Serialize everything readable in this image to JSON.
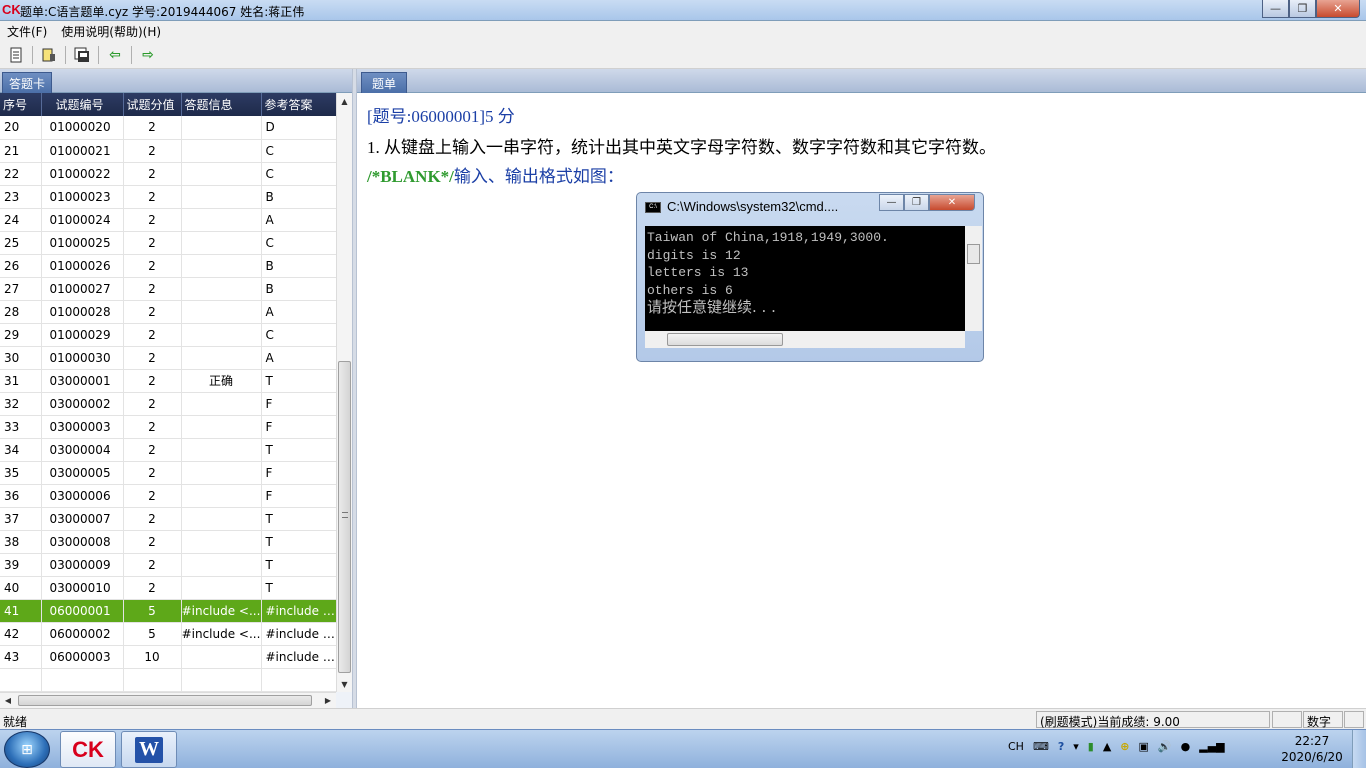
{
  "window": {
    "logo": "CK",
    "title": "题单:C语言题单.cyz  学号:2019444067 姓名:蒋正伟",
    "controls": {
      "min": "—",
      "max": "❐",
      "close": "✕"
    }
  },
  "menu": [
    "文件(F)",
    "使用说明(帮助)(H)"
  ],
  "toolbar": {
    "icons": [
      "open-doc-icon",
      "submit-icon",
      "save-icon",
      "prev-arrow-icon",
      "next-arrow-icon"
    ],
    "prev_glyph": "⇦",
    "next_glyph": "⇨"
  },
  "left": {
    "tab": "答题卡",
    "columns": [
      "序号",
      "试题编号",
      "试题分值",
      "答题信息",
      "参考答案"
    ],
    "rows": [
      [
        "20",
        "01000020",
        "2",
        "",
        "D"
      ],
      [
        "21",
        "01000021",
        "2",
        "",
        "C"
      ],
      [
        "22",
        "01000022",
        "2",
        "",
        "C"
      ],
      [
        "23",
        "01000023",
        "2",
        "",
        "B"
      ],
      [
        "24",
        "01000024",
        "2",
        "",
        "A"
      ],
      [
        "25",
        "01000025",
        "2",
        "",
        "C"
      ],
      [
        "26",
        "01000026",
        "2",
        "",
        "B"
      ],
      [
        "27",
        "01000027",
        "2",
        "",
        "B"
      ],
      [
        "28",
        "01000028",
        "2",
        "",
        "A"
      ],
      [
        "29",
        "01000029",
        "2",
        "",
        "C"
      ],
      [
        "30",
        "01000030",
        "2",
        "",
        "A"
      ],
      [
        "31",
        "03000001",
        "2",
        "正确",
        "T"
      ],
      [
        "32",
        "03000002",
        "2",
        "",
        "F"
      ],
      [
        "33",
        "03000003",
        "2",
        "",
        "F"
      ],
      [
        "34",
        "03000004",
        "2",
        "",
        "T"
      ],
      [
        "35",
        "03000005",
        "2",
        "",
        "F"
      ],
      [
        "36",
        "03000006",
        "2",
        "",
        "F"
      ],
      [
        "37",
        "03000007",
        "2",
        "",
        "T"
      ],
      [
        "38",
        "03000008",
        "2",
        "",
        "T"
      ],
      [
        "39",
        "03000009",
        "2",
        "",
        "T"
      ],
      [
        "40",
        "03000010",
        "2",
        "",
        "T"
      ],
      [
        "41",
        "06000001",
        "5",
        "#include <...",
        "#include <..."
      ],
      [
        "42",
        "06000002",
        "5",
        "#include <...",
        "#include <..."
      ],
      [
        "43",
        "06000003",
        "10",
        "",
        "#include <..."
      ],
      [
        "",
        "",
        "",
        "",
        ""
      ]
    ],
    "selected_index": 21
  },
  "right": {
    "tab": "题单",
    "header": "[题号:06000001]5 分",
    "question": "1.  从键盘上输入一串字符，统计出其中英文字母字符数、数字字符数和其它字符数。",
    "blank_tag": "/*BLANK*/",
    "blank_desc": "输入、输出格式如图：",
    "console": {
      "icon_text": "C:\\",
      "title": "C:\\Windows\\system32\\cmd....",
      "lines": [
        "Taiwan of China,1918,1949,3000.",
        "digits is 12",
        "letters is 13",
        "others is 6"
      ],
      "prompt": "请按任意键继续. . ."
    }
  },
  "status": {
    "ready": "就绪",
    "score": "(刷题模式)当前成绩: 9.00",
    "num": "数字"
  },
  "taskbar": {
    "start_glyph": "⊞",
    "ck_label": "CK",
    "word_label": "W",
    "tray_lang": "CH",
    "time": "22:27",
    "date": "2020/6/20"
  },
  "colors": {
    "selected_row": "#5ea819",
    "header_blue": "#1b3fa6",
    "blank_green": "#2f9a2f",
    "grid_header": "#1e2a4a"
  }
}
